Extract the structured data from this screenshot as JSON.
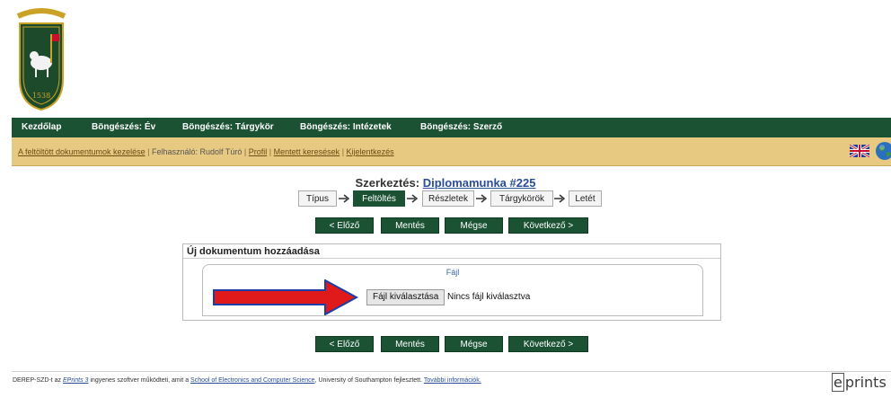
{
  "logo": {
    "motto": "GRANDO ET LABORANDO",
    "year": "1538",
    "icon": "university-crest-icon"
  },
  "nav": {
    "items": [
      "Kezdőlap",
      "Böngészés: Év",
      "Böngészés: Tárgykör",
      "Böngészés: Intézetek",
      "Böngészés: Szerző"
    ]
  },
  "userbar": {
    "manage": "A feltöltött dokumentumok kezelése",
    "sep": "|",
    "user": "Felhasználó: Rudolf Túró",
    "profile": "Profil",
    "saved": "Mentett keresések",
    "logout": "Kijelentkezés",
    "flag_icon": "uk-flag-icon",
    "globe_icon": "globe-icon"
  },
  "edit": {
    "prefix": "Szerkeztés:",
    "link": "Diplomamunka #225"
  },
  "stages": [
    "Típus",
    "Feltöltés",
    "Részletek",
    "Tárgykörök",
    "Letét"
  ],
  "active_stage": "Feltöltés",
  "buttons": {
    "prev": "< Előző",
    "save": "Mentés",
    "cancel": "Mégse",
    "next": "Következő >"
  },
  "panel": {
    "title": "Új dokumentum hozzáadása",
    "legend": "Fájl",
    "choose": "Fájl kiválasztása",
    "status": "Nincs fájl kiválasztva"
  },
  "annotation": {
    "arrow_color": "#e0191a"
  },
  "footer": {
    "t1": "DEREP-SZD-t az ",
    "link1": "EPrints 3",
    "t2": " ingyenes szoftver működteti, amit a ",
    "link2": "School of Electronics and Computer Science",
    "t3": ", University of Southampton fejlesztett. ",
    "link3": "További információk.",
    "logo_e": "e",
    "logo_rest": "prints"
  },
  "colors": {
    "nav_bg": "#1c5234",
    "userbar_bg": "#e7c982",
    "link": "#2a4d99"
  }
}
